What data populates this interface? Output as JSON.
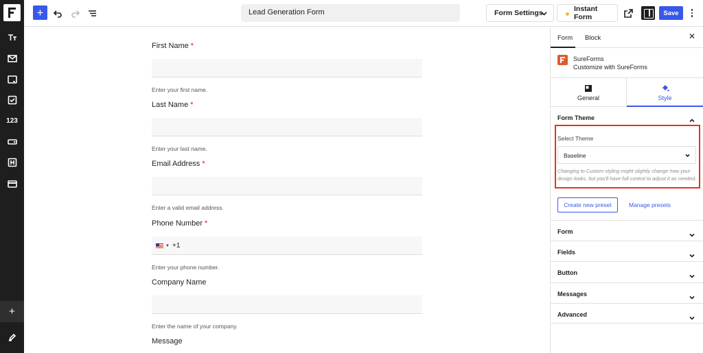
{
  "toolbar": {
    "title": "Lead Generation Form",
    "form_settings_label": "Form Settings",
    "instant_form_label": "Instant Form",
    "save_label": "Save",
    "icons": [
      "add-block-icon",
      "undo-icon",
      "redo-icon",
      "list-view-icon",
      "external-link-icon",
      "sidebar-toggle-icon",
      "more-options-icon"
    ],
    "accent_color": "#3858e9"
  },
  "rail": {
    "icons": [
      "logo-icon",
      "text-icon",
      "mail-icon",
      "input-icon",
      "checkbox-icon",
      "number-icon",
      "dropdown-icon",
      "heading-icon",
      "payment-icon",
      "plus-icon",
      "edit-icon"
    ],
    "number_label": "123"
  },
  "form": {
    "fields": [
      {
        "label": "First Name",
        "required": "*",
        "help": "Enter your first name."
      },
      {
        "label": "Last Name",
        "required": "*",
        "help": "Enter your last name."
      },
      {
        "label": "Email Address",
        "required": "*",
        "help": "Enter a valid email address."
      },
      {
        "label": "Phone Number",
        "required": "*",
        "help": "Enter your phone number.",
        "prefix": "+1"
      },
      {
        "label": "Company Name",
        "required": "",
        "help": "Enter the name of your company."
      },
      {
        "label": "Message",
        "required": "",
        "help": ""
      }
    ]
  },
  "panel": {
    "tabs": [
      "Form",
      "Block"
    ],
    "close": "✕",
    "plugin_name": "SureForms",
    "plugin_sub": "Customize with SureForms",
    "style_tabs": [
      "General",
      "Style"
    ],
    "theme_section": "Form Theme",
    "select_theme_label": "Select Theme",
    "select_theme_value": "Baseline",
    "theme_note": "Changing to Custom styling might slightly change how your design looks, but you'll have full control to adjust it as needed.",
    "create_preset": "Create new preset",
    "manage_presets": "Manage presets",
    "sections": [
      "Form",
      "Fields",
      "Button",
      "Messages",
      "Advanced"
    ],
    "highlight_color": "#e5331a"
  }
}
